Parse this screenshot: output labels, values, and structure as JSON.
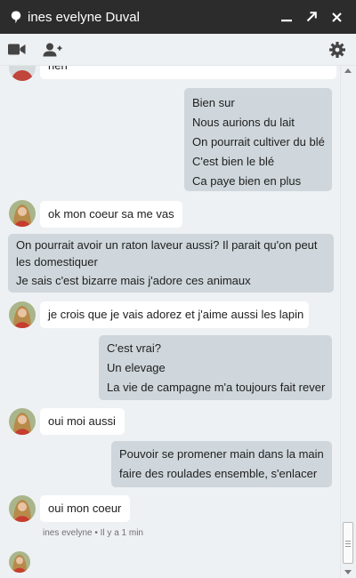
{
  "window": {
    "title": "ines evelyne Duval"
  },
  "messages": {
    "m0": [
      "rien"
    ],
    "m1": [
      "Bien sur",
      "Nous aurions du lait",
      "On pourrait cultiver du blé",
      "C'est bien le blé",
      "Ca paye bien en plus"
    ],
    "m2": [
      "ok mon coeur sa me vas"
    ],
    "m3": [
      "On pourrait avoir un raton laveur aussi? Il parait qu'on peut",
      "les domestiquer",
      "Je sais c'est bizarre mais j'adore ces animaux"
    ],
    "m4": [
      "je crois que je vais adorez et j'aime aussi les lapin"
    ],
    "m5": [
      "C'est vrai?",
      "Un elevage",
      "La vie de campagne m'a toujours fait rever"
    ],
    "m6": [
      "oui moi aussi"
    ],
    "m7": [
      "Pouvoir se promener main dans la main",
      "faire des roulades ensemble, s'enlacer"
    ],
    "m8": [
      "oui mon coeur"
    ]
  },
  "last_meta": "ines evelyne • Il y a 1 min",
  "icons": {
    "title": "chat-bubble-icon",
    "minimize": "minimize-icon",
    "popout": "popout-icon",
    "close": "close-icon",
    "video": "video-icon",
    "add_person": "add-person-icon",
    "settings": "gear-icon"
  },
  "colors": {
    "titlebar": "#2c2c2c",
    "chat_bg": "#eef1f3",
    "incoming_bubble": "#ffffff",
    "outgoing_bubble": "#cfd7dc"
  }
}
